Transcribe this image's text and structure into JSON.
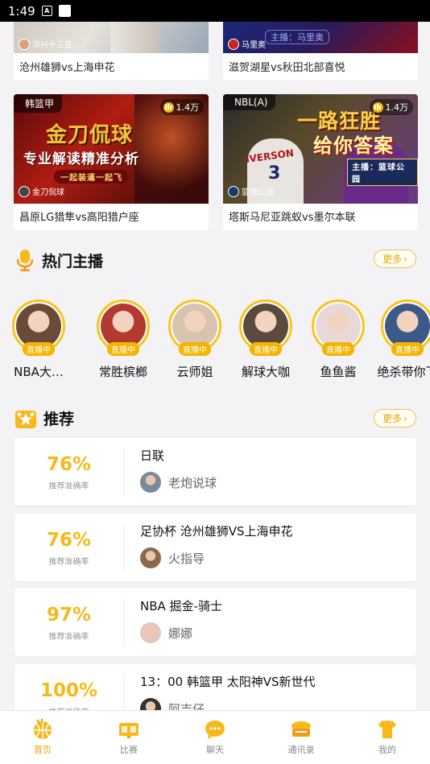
{
  "status_bar": {
    "time": "1:49",
    "icon_letter": "A"
  },
  "top_cards": [
    {
      "title": "沧州雄狮vs上海申花",
      "anchor": "洪兴十三豆"
    },
    {
      "title": "滋贺湖星vs秋田北部喜悦",
      "anchor": "马里奥",
      "overlay": "主播：马里奥"
    }
  ],
  "video_cards": [
    {
      "tag": "韩篮甲",
      "views": "1.4万",
      "anchor": "金刀侃球",
      "promo_line1": "金刀侃球",
      "promo_line2": "专业解读精准分析",
      "promo_line3": "一起装逼一起飞",
      "title": "昌原LG猎隼vs高阳猎户座"
    },
    {
      "tag": "NBL(A)",
      "views": "1.4万",
      "anchor": "篮球公园",
      "promo_line1": "一路狂胜",
      "promo_line2": "给你答案",
      "jersey": "IVERSON",
      "jersey_num": "3",
      "promo_sub": "主播：篮球公园",
      "title": "塔斯马尼亚跳蚁vs墨尔本联"
    }
  ],
  "hot_anchors": {
    "title": "热门主播",
    "more": "更多",
    "live_label": "直播中",
    "items": [
      {
        "name": "NBA大…",
        "color": "#6b4a3a"
      },
      {
        "name": "常胜槟榔",
        "color": "#b23a2f"
      },
      {
        "name": "云师姐",
        "color": "#d8c2b0"
      },
      {
        "name": "解球大咖",
        "color": "#5b4a3e"
      },
      {
        "name": "鱼鱼酱",
        "color": "#e7d9d8"
      },
      {
        "name": "绝杀带你飞",
        "color": "#3b5a8a"
      }
    ]
  },
  "recommend": {
    "title": "推荐",
    "more": "更多",
    "items": [
      {
        "pct": "76%",
        "label": "推荐准确率",
        "title": "日联",
        "user": "老炮说球",
        "avatar": "#7a8a9a"
      },
      {
        "pct": "76%",
        "label": "推荐准确率",
        "title": "足协杯 沧州雄狮VS上海申花",
        "user": "火指导",
        "avatar": "#8a6a4a"
      },
      {
        "pct": "97%",
        "label": "推荐准确率",
        "title": "NBA 掘金-骑士",
        "user": "娜娜",
        "avatar": "#e7c6bb"
      },
      {
        "pct": "100%",
        "label": "推荐准确率",
        "title": "13：00 韩篮甲 太阳神VS新世代",
        "user": "阿吉仔",
        "avatar": "#333333"
      }
    ]
  },
  "tabs": [
    {
      "label": "首页",
      "icon": "basketball-icon",
      "active": true
    },
    {
      "label": "比赛",
      "icon": "scoreboard-icon",
      "active": false
    },
    {
      "label": "聊天",
      "icon": "chat-bubble-icon",
      "active": false
    },
    {
      "label": "通讯录",
      "icon": "contacts-icon",
      "active": false
    },
    {
      "label": "我的",
      "icon": "jersey-icon",
      "active": false
    }
  ],
  "colors": {
    "accent": "#f5a400",
    "gold": "#f7c51b",
    "percent": "#f7b81a"
  }
}
